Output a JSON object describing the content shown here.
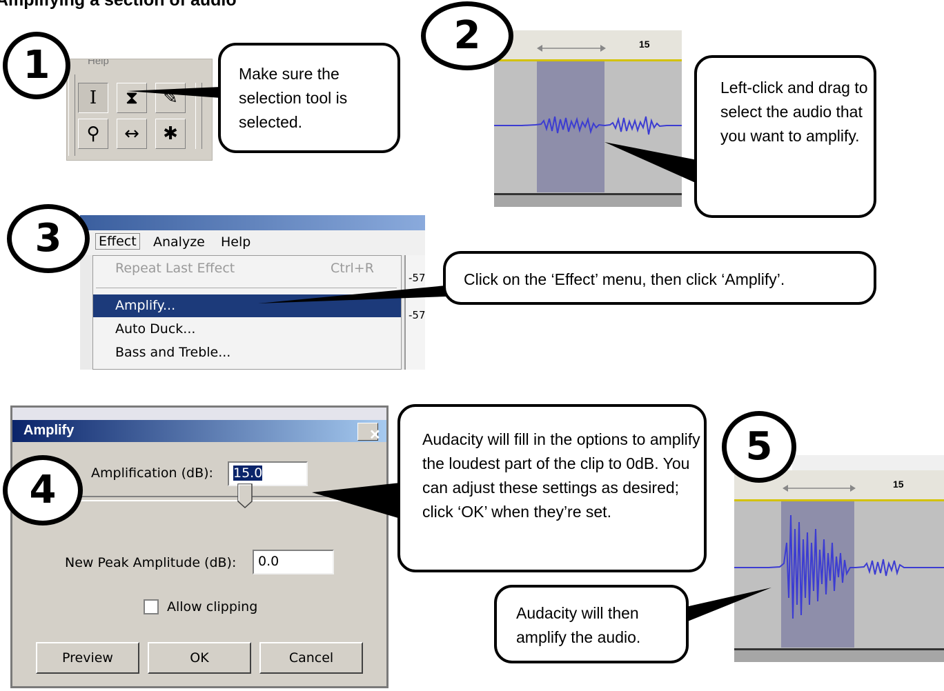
{
  "page": {
    "title": "Amplifying a section of audio"
  },
  "steps": {
    "s1": "1",
    "s2": "2",
    "s3": "3",
    "s4": "4",
    "s5": "5"
  },
  "callouts": {
    "c1": "Make sure the selection tool is selected.",
    "c2": "Left-click and drag to select the audio that you want to amplify.",
    "c3": "Click on the ‘Effect’ menu, then click ‘Amplify’.",
    "c4": "Audacity will fill in the options to amplify the loudest part of the clip to 0dB. You can adjust these settings as desired; click ‘OK’ when they’re set.",
    "c5": "Audacity will then amplify the audio."
  },
  "toolbar": {
    "help_label": "Help",
    "tools": [
      {
        "name": "selection-tool",
        "glyph": "I",
        "selected": true
      },
      {
        "name": "envelope-tool",
        "glyph": "⧗",
        "selected": false
      },
      {
        "name": "draw-tool",
        "glyph": "✎",
        "selected": false
      },
      {
        "name": "zoom-tool",
        "glyph": "⚲",
        "selected": false
      },
      {
        "name": "timeshift-tool",
        "glyph": "↔",
        "selected": false
      },
      {
        "name": "multi-tool",
        "glyph": "✱",
        "selected": false
      }
    ]
  },
  "timeline": {
    "tick_label": "15"
  },
  "menu": {
    "menubar": [
      "Effect",
      "Analyze",
      "Help"
    ],
    "items": [
      {
        "label": "Repeat Last Effect",
        "shortcut": "Ctrl+R",
        "disabled": true
      },
      {
        "label": "Amplify...",
        "highlighted": true
      },
      {
        "label": "Auto Duck..."
      },
      {
        "label": "Bass and Treble..."
      }
    ],
    "side_values": [
      "-57",
      "-57"
    ]
  },
  "dialog": {
    "title": "Amplify",
    "close_glyph": "✕",
    "amplification_label": "Amplification (dB):",
    "amplification_value": "15.0",
    "peak_label": "New Peak Amplitude (dB):",
    "peak_value": "0.0",
    "allow_clipping_label": "Allow clipping",
    "allow_clipping_checked": false,
    "buttons": {
      "preview": "Preview",
      "ok": "OK",
      "cancel": "Cancel"
    }
  },
  "colors": {
    "waveform": "#3c3cd2",
    "selection": "#8e8eaa",
    "menu_highlight": "#1c3a7a",
    "dialog_title": "#0a246a"
  }
}
